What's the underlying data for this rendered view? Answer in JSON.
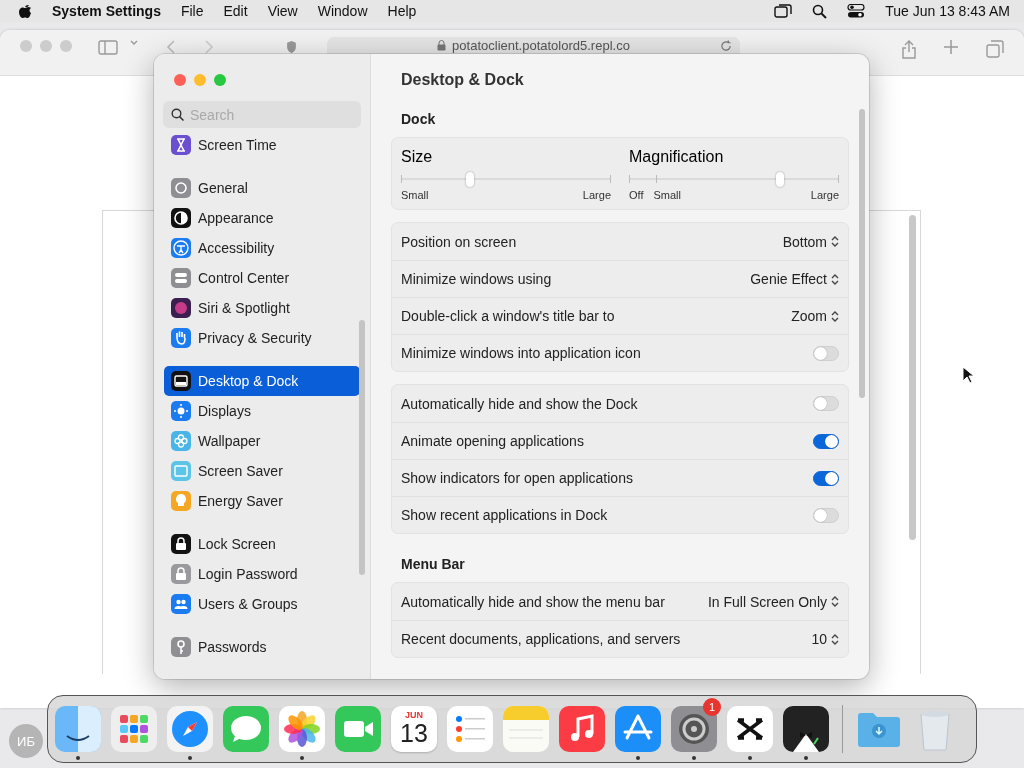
{
  "menu_bar": {
    "app_name": "System Settings",
    "menus": [
      "File",
      "Edit",
      "View",
      "Window",
      "Help"
    ],
    "clock": "Tue Jun 13  8:43 AM"
  },
  "browser": {
    "url": "potatoclient.potatolord5.repl.co"
  },
  "settings": {
    "title": "Desktop & Dock",
    "search": {
      "placeholder": "Search"
    },
    "sidebar": [
      [
        {
          "label": "Screen Time",
          "kind": "hourglass",
          "selected": false
        }
      ],
      [
        {
          "label": "General",
          "kind": "gear",
          "selected": false
        },
        {
          "label": "Appearance",
          "kind": "half-circle",
          "selected": false
        },
        {
          "label": "Accessibility",
          "kind": "figure",
          "selected": false
        },
        {
          "label": "Control Center",
          "kind": "switches",
          "selected": false
        },
        {
          "label": "Siri & Spotlight",
          "kind": "orb",
          "selected": false
        },
        {
          "label": "Privacy & Security",
          "kind": "hand",
          "selected": false
        }
      ],
      [
        {
          "label": "Desktop & Dock",
          "kind": "dock",
          "selected": true
        },
        {
          "label": "Displays",
          "kind": "sun",
          "selected": false
        },
        {
          "label": "Wallpaper",
          "kind": "flower",
          "selected": false
        },
        {
          "label": "Screen Saver",
          "kind": "screen",
          "selected": false
        },
        {
          "label": "Energy Saver",
          "kind": "bulb",
          "selected": false
        }
      ],
      [
        {
          "label": "Lock Screen",
          "kind": "lock",
          "selected": false
        },
        {
          "label": "Login Password",
          "kind": "padlock",
          "selected": false
        },
        {
          "label": "Users & Groups",
          "kind": "users",
          "selected": false
        }
      ],
      [
        {
          "label": "Passwords",
          "kind": "key",
          "selected": false
        }
      ]
    ],
    "sections": [
      {
        "heading": "Dock",
        "sliders": [
          {
            "label": "Size",
            "level": 0.33,
            "labels": [
              "Small",
              "Large"
            ]
          },
          {
            "label": "Magnification",
            "level": 0.72,
            "labels": [
              "Off",
              "Small",
              "Large"
            ]
          }
        ],
        "groups": [
          [
            {
              "kind": "popup",
              "label": "Position on screen",
              "value": "Bottom"
            },
            {
              "kind": "popup",
              "label": "Minimize windows using",
              "value": "Genie Effect"
            },
            {
              "kind": "popup",
              "label": "Double-click a window's title bar to",
              "value": "Zoom"
            },
            {
              "kind": "toggle",
              "label": "Minimize windows into application icon",
              "on": false
            }
          ],
          [
            {
              "kind": "toggle",
              "label": "Automatically hide and show the Dock",
              "on": false
            },
            {
              "kind": "toggle",
              "label": "Animate opening applications",
              "on": true
            },
            {
              "kind": "toggle",
              "label": "Show indicators for open applications",
              "on": true
            },
            {
              "kind": "toggle",
              "label": "Show recent applications in Dock",
              "on": false
            }
          ]
        ]
      },
      {
        "heading": "Menu Bar",
        "groups": [
          [
            {
              "kind": "popup",
              "label": "Automatically hide and show the menu bar",
              "value": "In Full Screen Only"
            },
            {
              "kind": "popup",
              "label": "Recent documents, applications, and servers",
              "value": "10"
            }
          ]
        ]
      }
    ]
  },
  "avatar": {
    "initials": "ИБ"
  },
  "dock": [
    {
      "kind": "finder",
      "running": true
    },
    {
      "kind": "launchpad",
      "running": false
    },
    {
      "kind": "safari",
      "running": true
    },
    {
      "kind": "messages",
      "running": false
    },
    {
      "kind": "photos",
      "running": true
    },
    {
      "kind": "facetime",
      "running": false
    },
    {
      "kind": "calendar",
      "running": false,
      "month": "JUN",
      "day": "13"
    },
    {
      "kind": "reminders",
      "running": false
    },
    {
      "kind": "notes",
      "running": false
    },
    {
      "kind": "music",
      "running": false
    },
    {
      "kind": "appstore",
      "running": true
    },
    {
      "kind": "settings",
      "running": true,
      "badge": "1"
    },
    {
      "kind": "capcut",
      "running": true
    },
    {
      "kind": "bartender",
      "running": true
    },
    {
      "kind": "separator"
    },
    {
      "kind": "downloads",
      "running": false
    },
    {
      "kind": "trash",
      "running": false
    }
  ]
}
